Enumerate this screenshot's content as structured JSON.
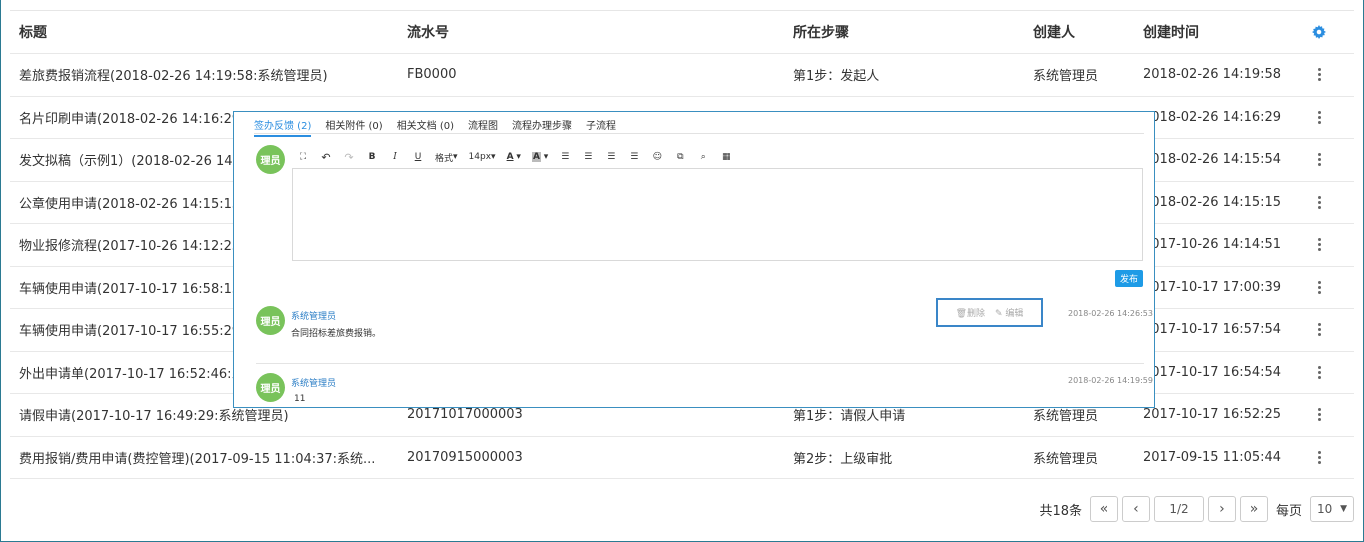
{
  "table": {
    "headers": {
      "title": "标题",
      "serial": "流水号",
      "step": "所在步骤",
      "creator": "创建人",
      "created": "创建时间"
    },
    "rows": [
      {
        "title": "差旅费报销流程(2018-02-26 14:19:58:系统管理员)",
        "serial": "FB0000",
        "step": "第1步：发起人",
        "creator": "系统管理员",
        "created": "2018-02-26 14:19:58"
      },
      {
        "title": "名片印刷申请(2018-02-26 14:16:29",
        "serial": "",
        "step": "",
        "creator": "",
        "created": "2018-02-26 14:16:29"
      },
      {
        "title": "发文拟稿（示例1）(2018-02-26 14",
        "serial": "",
        "step": "",
        "creator": "",
        "created": "2018-02-26 14:15:54"
      },
      {
        "title": "公章使用申请(2018-02-26 14:15:15",
        "serial": "",
        "step": "",
        "creator": "",
        "created": "2018-02-26 14:15:15"
      },
      {
        "title": "物业报修流程(2017-10-26 14:12:25",
        "serial": "",
        "step": "",
        "creator": "",
        "created": "2017-10-26 14:14:51"
      },
      {
        "title": "车辆使用申请(2017-10-17 16:58:15",
        "serial": "",
        "step": "",
        "creator": "",
        "created": "2017-10-17 17:00:39"
      },
      {
        "title": "车辆使用申请(2017-10-17 16:55:29",
        "serial": "",
        "step": "",
        "creator": "",
        "created": "2017-10-17 16:57:54"
      },
      {
        "title": "外出申请单(2017-10-17 16:52:46:系",
        "serial": "",
        "step": "",
        "creator": "",
        "created": "2017-10-17 16:54:54"
      },
      {
        "title": "请假申请(2017-10-17 16:49:29:系统管理员)",
        "serial": "20171017000003",
        "step": "第1步：请假人申请",
        "creator": "系统管理员",
        "created": "2017-10-17 16:52:25"
      },
      {
        "title": "费用报销/费用申请(费控管理)(2017-09-15 11:04:37:系统...",
        "serial": "20170915000003",
        "step": "第2步：上级审批",
        "creator": "系统管理员",
        "created": "2017-09-15 11:05:44"
      }
    ]
  },
  "pager": {
    "total": "共18条",
    "page": "1/2",
    "per_page_label": "每页",
    "per_page": "10",
    "first": "«",
    "prev": "‹",
    "next": "›",
    "last": "»"
  },
  "popup": {
    "tabs": [
      "签办反馈 (2)",
      "相关附件 (0)",
      "相关文档 (0)",
      "流程图",
      "流程办理步骤",
      "子流程"
    ],
    "avatar_text": "理员",
    "toolbar": {
      "format": "格式",
      "size": "14px",
      "font_color": "A",
      "bg_color": "A"
    },
    "publish": "发布",
    "comments": [
      {
        "author": "系统管理员",
        "text": "合同招标差旅费报销。",
        "time": "2018-02-26 14:26:53",
        "delete": "删除",
        "edit": "编辑"
      },
      {
        "author": "系统管理员",
        "text": "11",
        "time": "2018-02-26 14:19:59"
      }
    ]
  },
  "colors": {
    "accent": "#2b8ee0",
    "avatar": "#79c35b",
    "publish": "#1e9be6"
  }
}
